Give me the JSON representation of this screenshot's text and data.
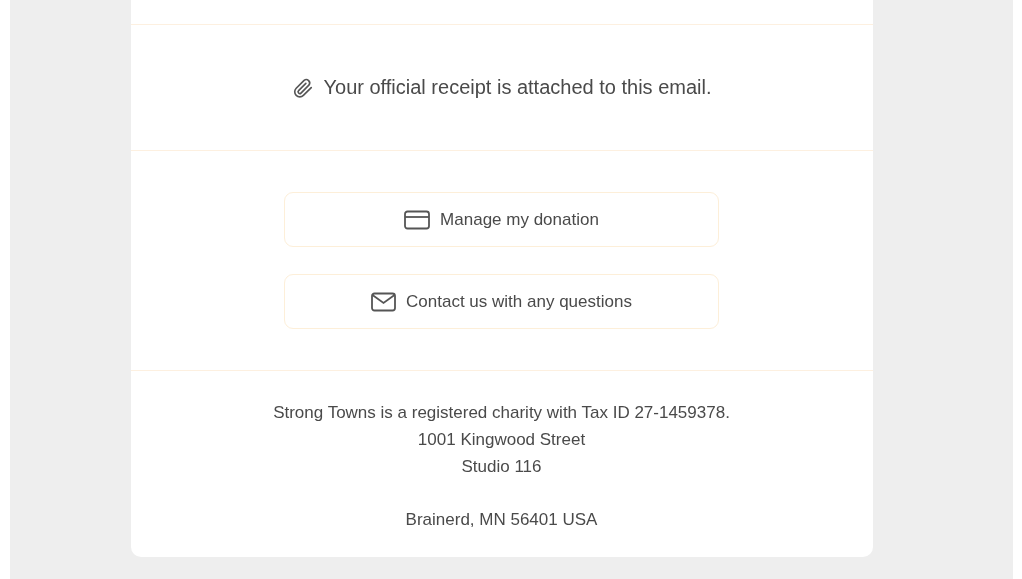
{
  "attachment_note": {
    "text": "Your official receipt is attached to this email."
  },
  "actions": [
    {
      "kind": "card",
      "label": "Manage my donation"
    },
    {
      "kind": "mail",
      "label": "Contact us with any questions"
    }
  ],
  "footer": {
    "charity_line": "Strong Towns is a registered charity with Tax ID 27-1459378.",
    "address": [
      "1001 Kingwood Street",
      "Studio 116"
    ],
    "city_line": "Brainerd, MN 56401 USA"
  }
}
